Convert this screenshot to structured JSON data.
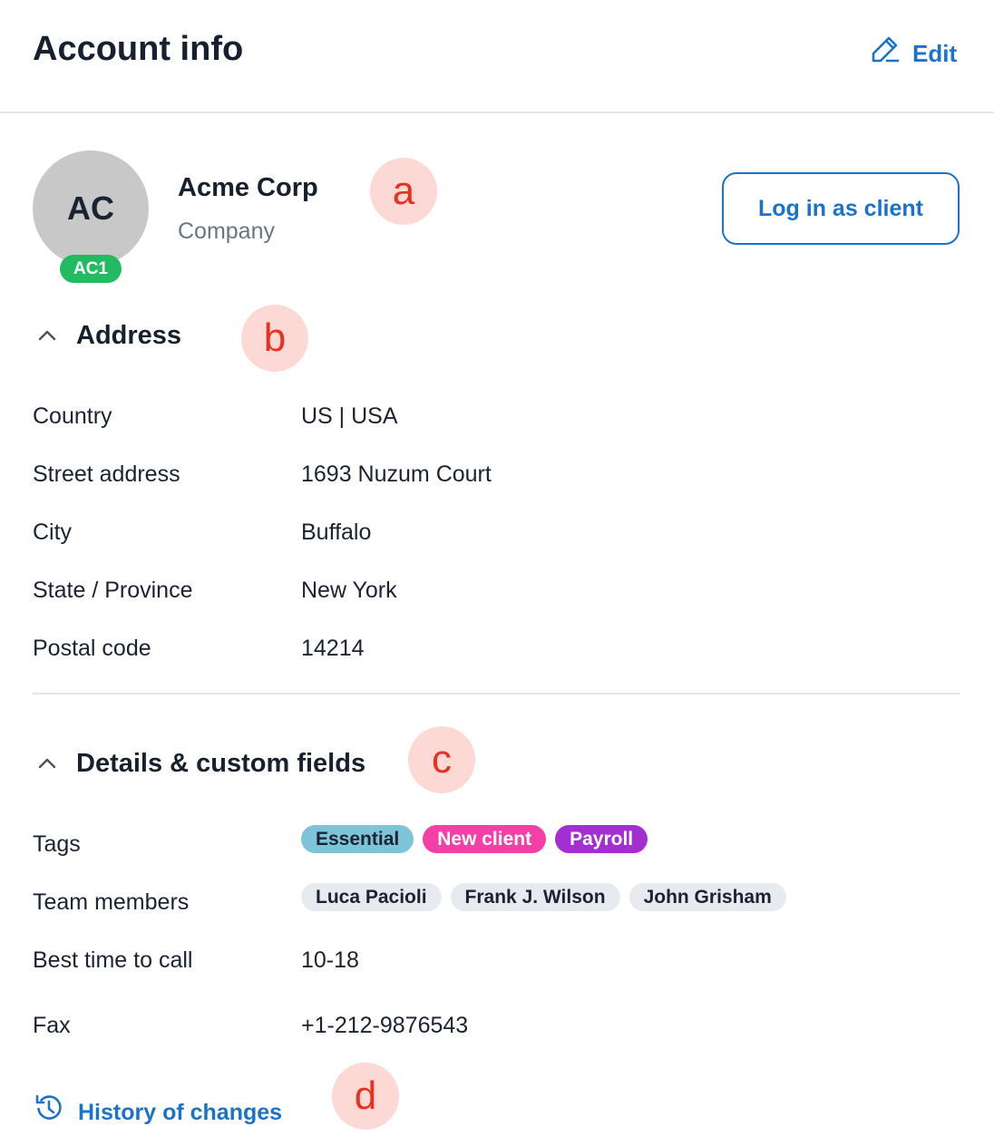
{
  "header": {
    "title": "Account info",
    "edit_label": "Edit"
  },
  "client": {
    "initials": "AC",
    "badge": "AC1",
    "name": "Acme Corp",
    "type": "Company",
    "login_label": "Log in as client"
  },
  "markers": {
    "a": "a",
    "b": "b",
    "c": "c",
    "d": "d"
  },
  "address": {
    "title": "Address",
    "rows": [
      {
        "label": "Country",
        "value": "US | USA"
      },
      {
        "label": "Street address",
        "value": "1693 Nuzum Court"
      },
      {
        "label": "City",
        "value": "Buffalo"
      },
      {
        "label": "State / Province",
        "value": "New York"
      },
      {
        "label": "Postal code",
        "value": "14214"
      }
    ]
  },
  "details": {
    "title": "Details & custom fields",
    "tags_label": "Tags",
    "tags": [
      {
        "label": "Essential",
        "color": "#7ec4d8",
        "text_color": "#1b2332"
      },
      {
        "label": "New client",
        "color": "#f43fa6",
        "text_color": "#ffffff"
      },
      {
        "label": "Payroll",
        "color": "#a32fd3",
        "text_color": "#ffffff"
      }
    ],
    "team_label": "Team members",
    "team_members": [
      "Luca Pacioli",
      "Frank J. Wilson",
      "John Grisham"
    ],
    "call_label": "Best time to call",
    "call_value": "10-18",
    "fax_label": "Fax",
    "fax_value": "+1-212-9876543"
  },
  "history_label": "History of changes",
  "colors": {
    "accent": "#1a73c9",
    "badge_green": "#22bb62",
    "marker_bg": "#fcd9d5",
    "marker_text": "#e8311e"
  },
  "icons": {
    "edit": "pencil-icon",
    "collapse": "chevron-up-icon",
    "history": "history-icon"
  }
}
